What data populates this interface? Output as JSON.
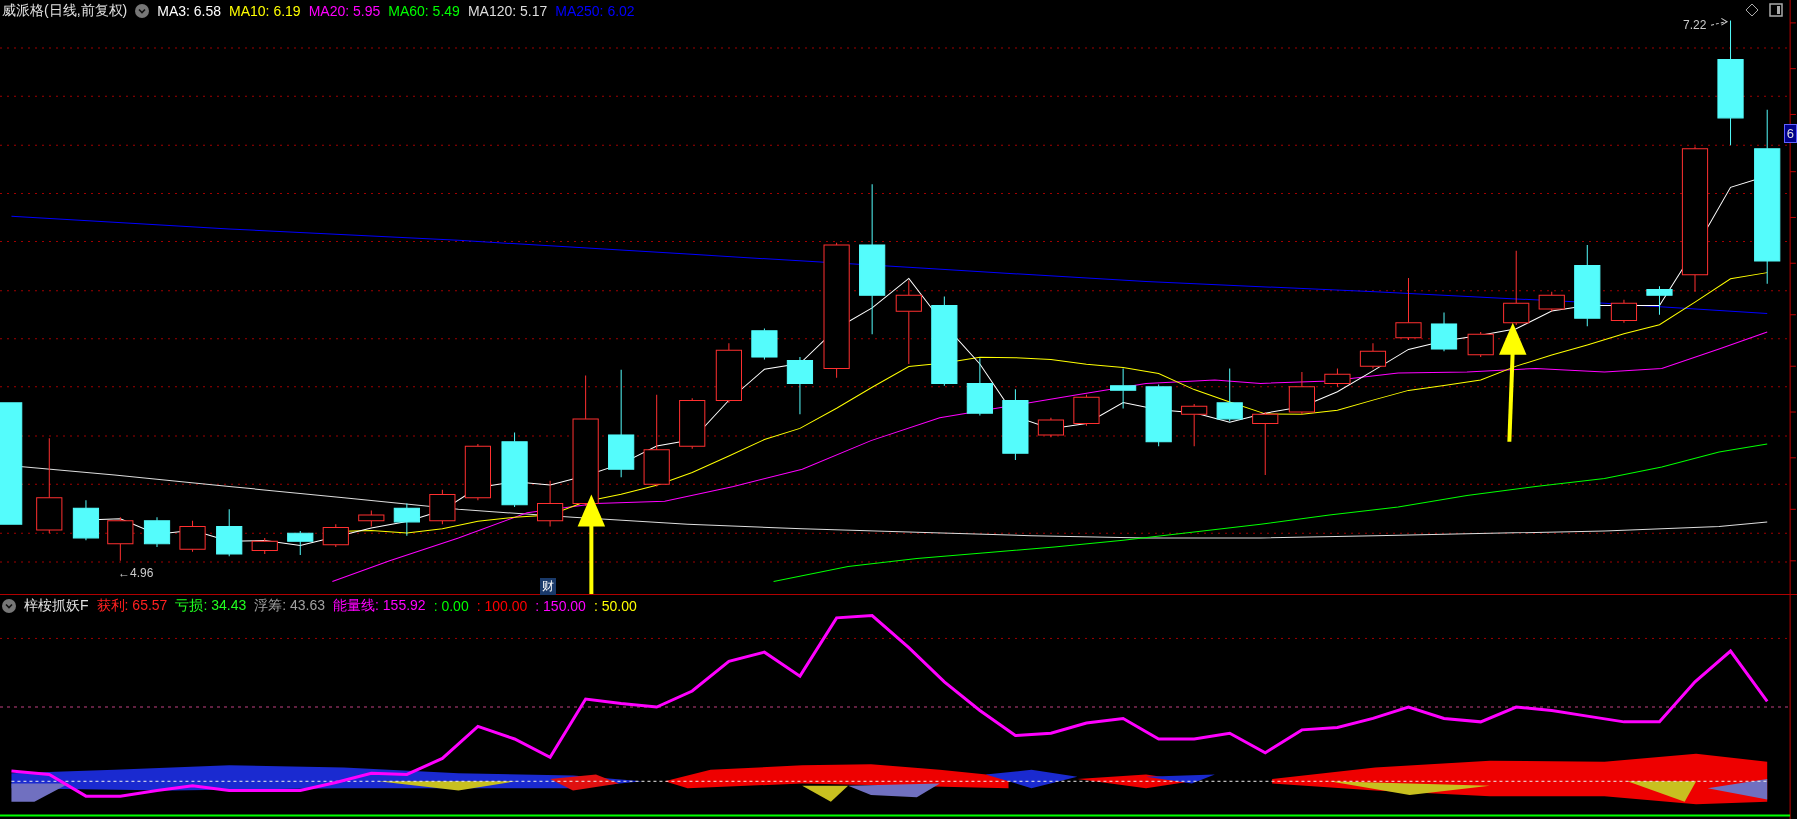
{
  "title": "威派格(日线,前复权)",
  "ma_legend": [
    {
      "label": "MA3: 6.58",
      "color": "#ffffff"
    },
    {
      "label": "MA10: 6.19",
      "color": "#ffff00"
    },
    {
      "label": "MA20: 5.95",
      "color": "#ff00ff"
    },
    {
      "label": "MA60: 5.49",
      "color": "#00ff00"
    },
    {
      "label": "MA120: 5.17",
      "color": "#dddddd"
    },
    {
      "label": "MA250: 6.02",
      "color": "#0000ff"
    }
  ],
  "high_label": "7.22",
  "low_label": "←4.96",
  "axis_badge": "6",
  "event_badge": "财",
  "indicator": {
    "name": "梓桉抓妖F",
    "values": [
      {
        "label": "获利: 65.57",
        "color": "#ff2020"
      },
      {
        "label": "亏损: 34.43",
        "color": "#20ff20"
      },
      {
        "label": "浮筹: 43.63",
        "color": "#a0a0a0"
      },
      {
        "label": "能量线: 155.92",
        "color": "#ff00ff"
      },
      {
        "label": ": 0.00",
        "color": "#00ff00"
      },
      {
        "label": ": 100.00",
        "color": "#ff0000"
      },
      {
        "label": ": 150.00",
        "color": "#ff00ff"
      },
      {
        "label": ": 50.00",
        "color": "#ffff00"
      }
    ]
  }
}
